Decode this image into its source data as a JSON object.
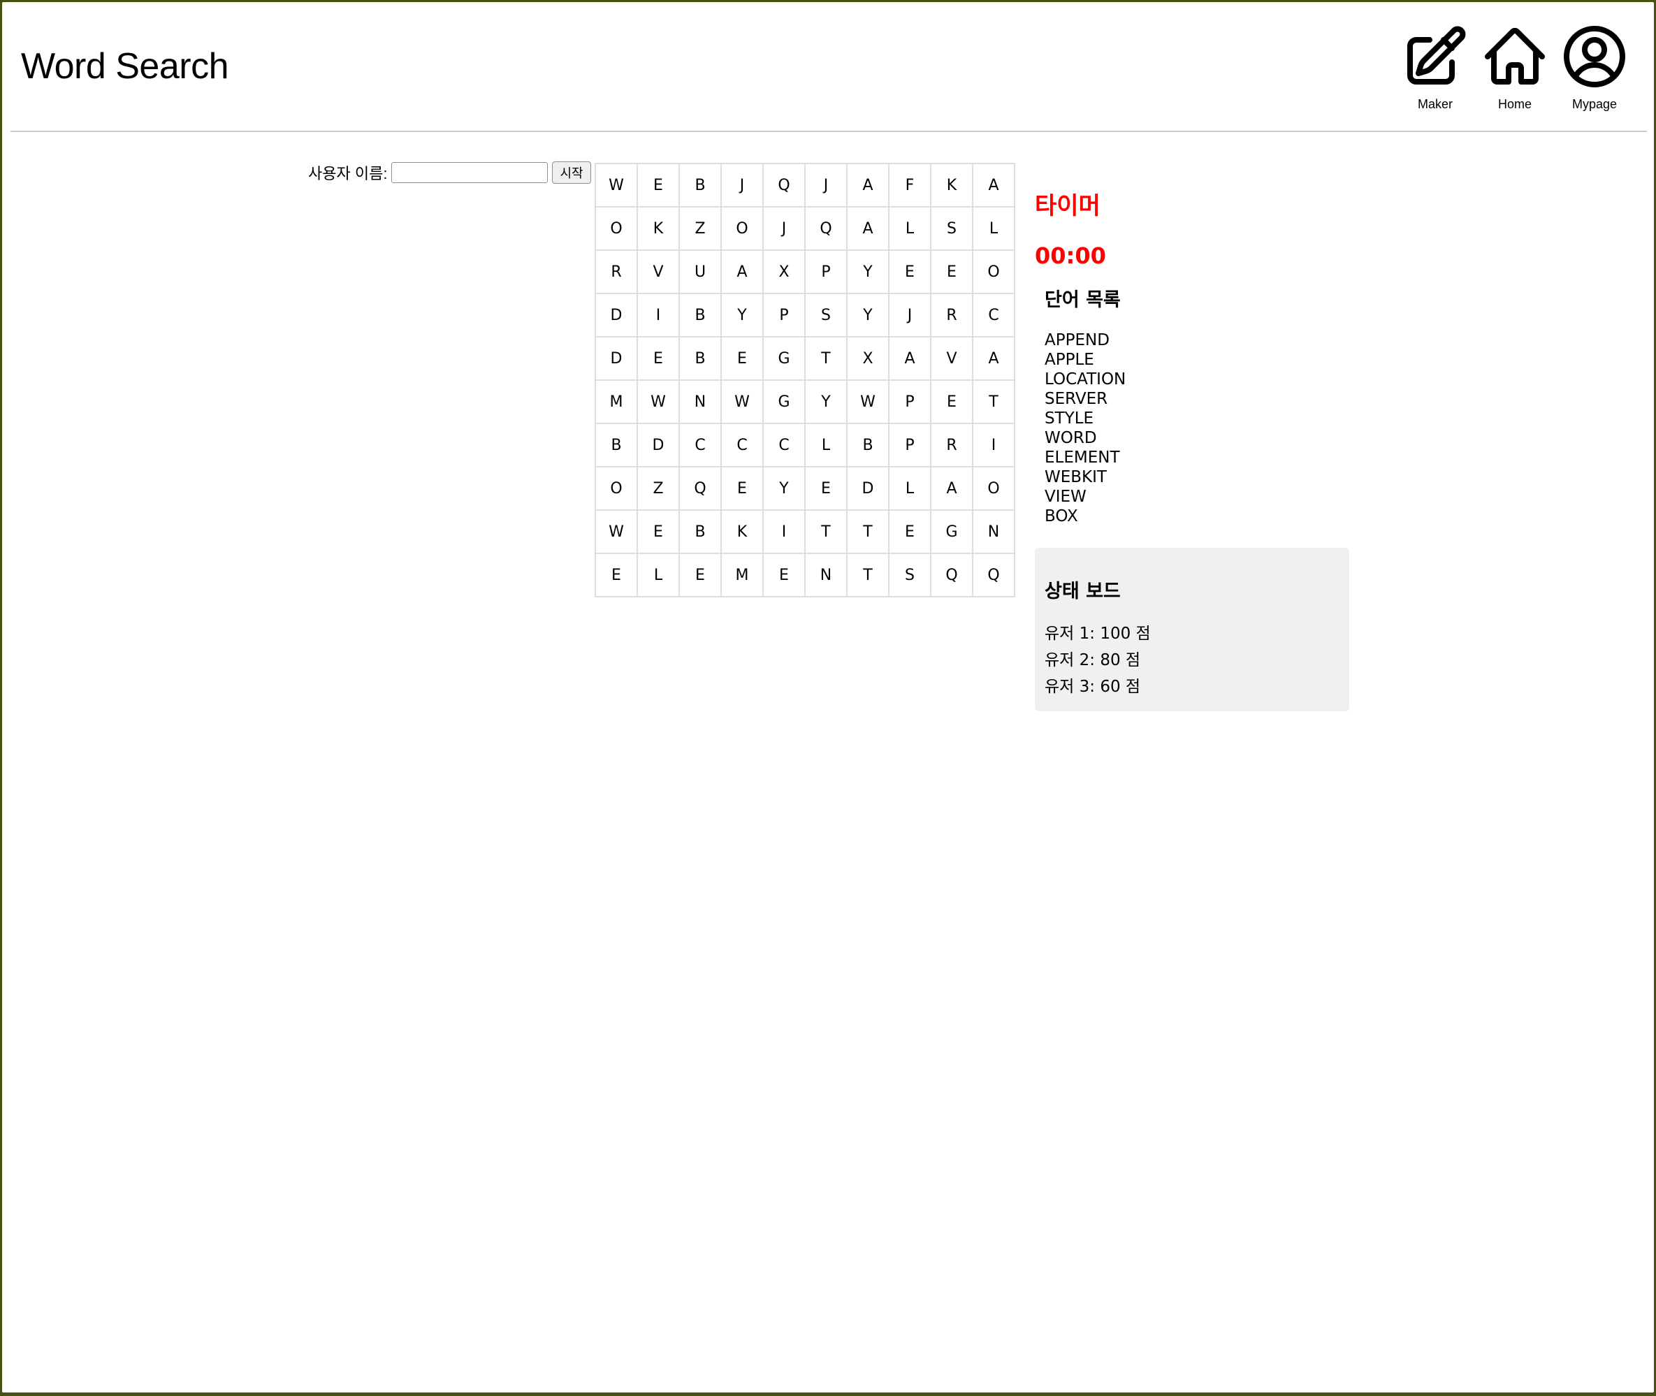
{
  "header": {
    "title": "Word Search",
    "nav": [
      {
        "label": "Maker",
        "icon": "pencil-square-icon"
      },
      {
        "label": "Home",
        "icon": "home-icon"
      },
      {
        "label": "Mypage",
        "icon": "user-circle-icon"
      }
    ]
  },
  "controls": {
    "username_label": "사용자 이름:",
    "username_value": "",
    "start_label": "시작"
  },
  "grid": [
    [
      "W",
      "E",
      "B",
      "J",
      "Q",
      "J",
      "A",
      "F",
      "K",
      "A"
    ],
    [
      "O",
      "K",
      "Z",
      "O",
      "J",
      "Q",
      "A",
      "L",
      "S",
      "L"
    ],
    [
      "R",
      "V",
      "U",
      "A",
      "X",
      "P",
      "Y",
      "E",
      "E",
      "O"
    ],
    [
      "D",
      "I",
      "B",
      "Y",
      "P",
      "S",
      "Y",
      "J",
      "R",
      "C"
    ],
    [
      "D",
      "E",
      "B",
      "E",
      "G",
      "T",
      "X",
      "A",
      "V",
      "A"
    ],
    [
      "M",
      "W",
      "N",
      "W",
      "G",
      "Y",
      "W",
      "P",
      "E",
      "T"
    ],
    [
      "B",
      "D",
      "C",
      "C",
      "C",
      "L",
      "B",
      "P",
      "R",
      "I"
    ],
    [
      "O",
      "Z",
      "Q",
      "E",
      "Y",
      "E",
      "D",
      "L",
      "A",
      "O"
    ],
    [
      "W",
      "E",
      "B",
      "K",
      "I",
      "T",
      "T",
      "E",
      "G",
      "N"
    ],
    [
      "E",
      "L",
      "E",
      "M",
      "E",
      "N",
      "T",
      "S",
      "Q",
      "Q"
    ]
  ],
  "timer": {
    "title": "타이머",
    "value": "00:00",
    "color": "#ff0000"
  },
  "words": {
    "title": "단어 목록",
    "items": [
      "APPEND",
      "APPLE",
      "LOCATION",
      "SERVER",
      "STYLE",
      "WORD",
      "ELEMENT",
      "WEBKIT",
      "VIEW",
      "BOX"
    ]
  },
  "status": {
    "title": "상태 보드",
    "scores": [
      "유저 1: 100 점",
      "유저 2: 80 점",
      "유저 3: 60 점"
    ],
    "background": "#f0f0f0"
  }
}
